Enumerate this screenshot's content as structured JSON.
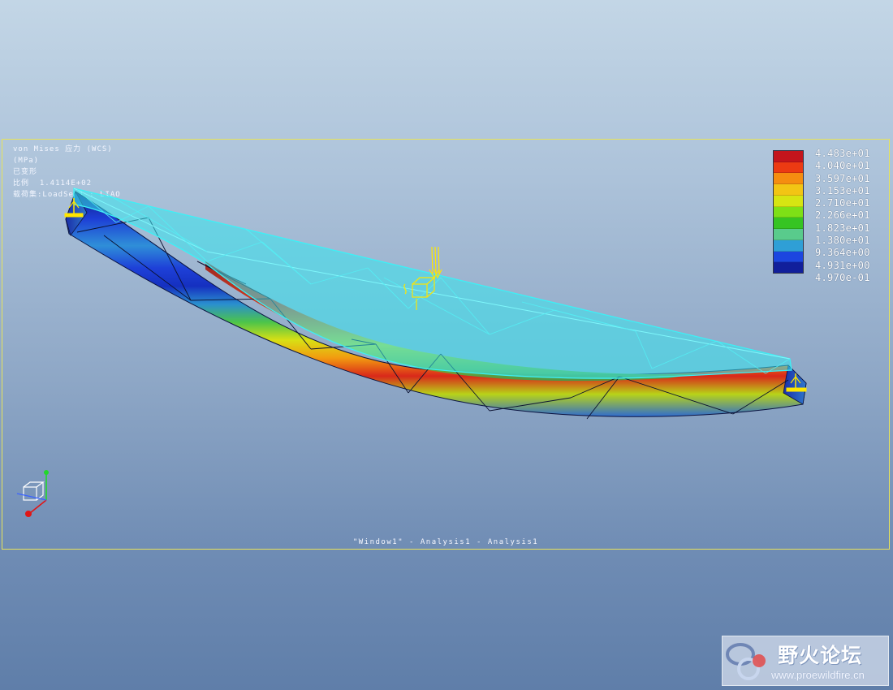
{
  "result_info": {
    "line1": "von Mises 应力 (WCS)",
    "line2": "(MPa)",
    "line3": "已变形",
    "line4": "比例  1.4114E+02",
    "line5": "载荷集:LoadSet1 : LIAO"
  },
  "legend": {
    "colors": [
      "#c4151c",
      "#ec3a12",
      "#f58d10",
      "#f2c514",
      "#d6e512",
      "#7ee016",
      "#36c422",
      "#59cb8c",
      "#2f9fd6",
      "#1c46e0",
      "#111f9b"
    ],
    "values": [
      "4.483e+01",
      "4.040e+01",
      "3.597e+01",
      "3.153e+01",
      "2.710e+01",
      "2.266e+01",
      "1.823e+01",
      "1.380e+01",
      "9.364e+00",
      "4.931e+00",
      "4.970e-01"
    ]
  },
  "window_caption": "\"Window1\" - Analysis1 - Analysis1",
  "watermark": {
    "title": "野火论坛",
    "url": "www.proewildfire.cn"
  },
  "colors": {
    "viewport_border": "#e7e35a",
    "undeformed_mesh": "#37e6ef",
    "constraint": "#ffe600"
  },
  "icons": [
    "coordinate-triad-icon",
    "load-arrow-icon",
    "constraint-icon",
    "butterfly-logo-icon"
  ]
}
